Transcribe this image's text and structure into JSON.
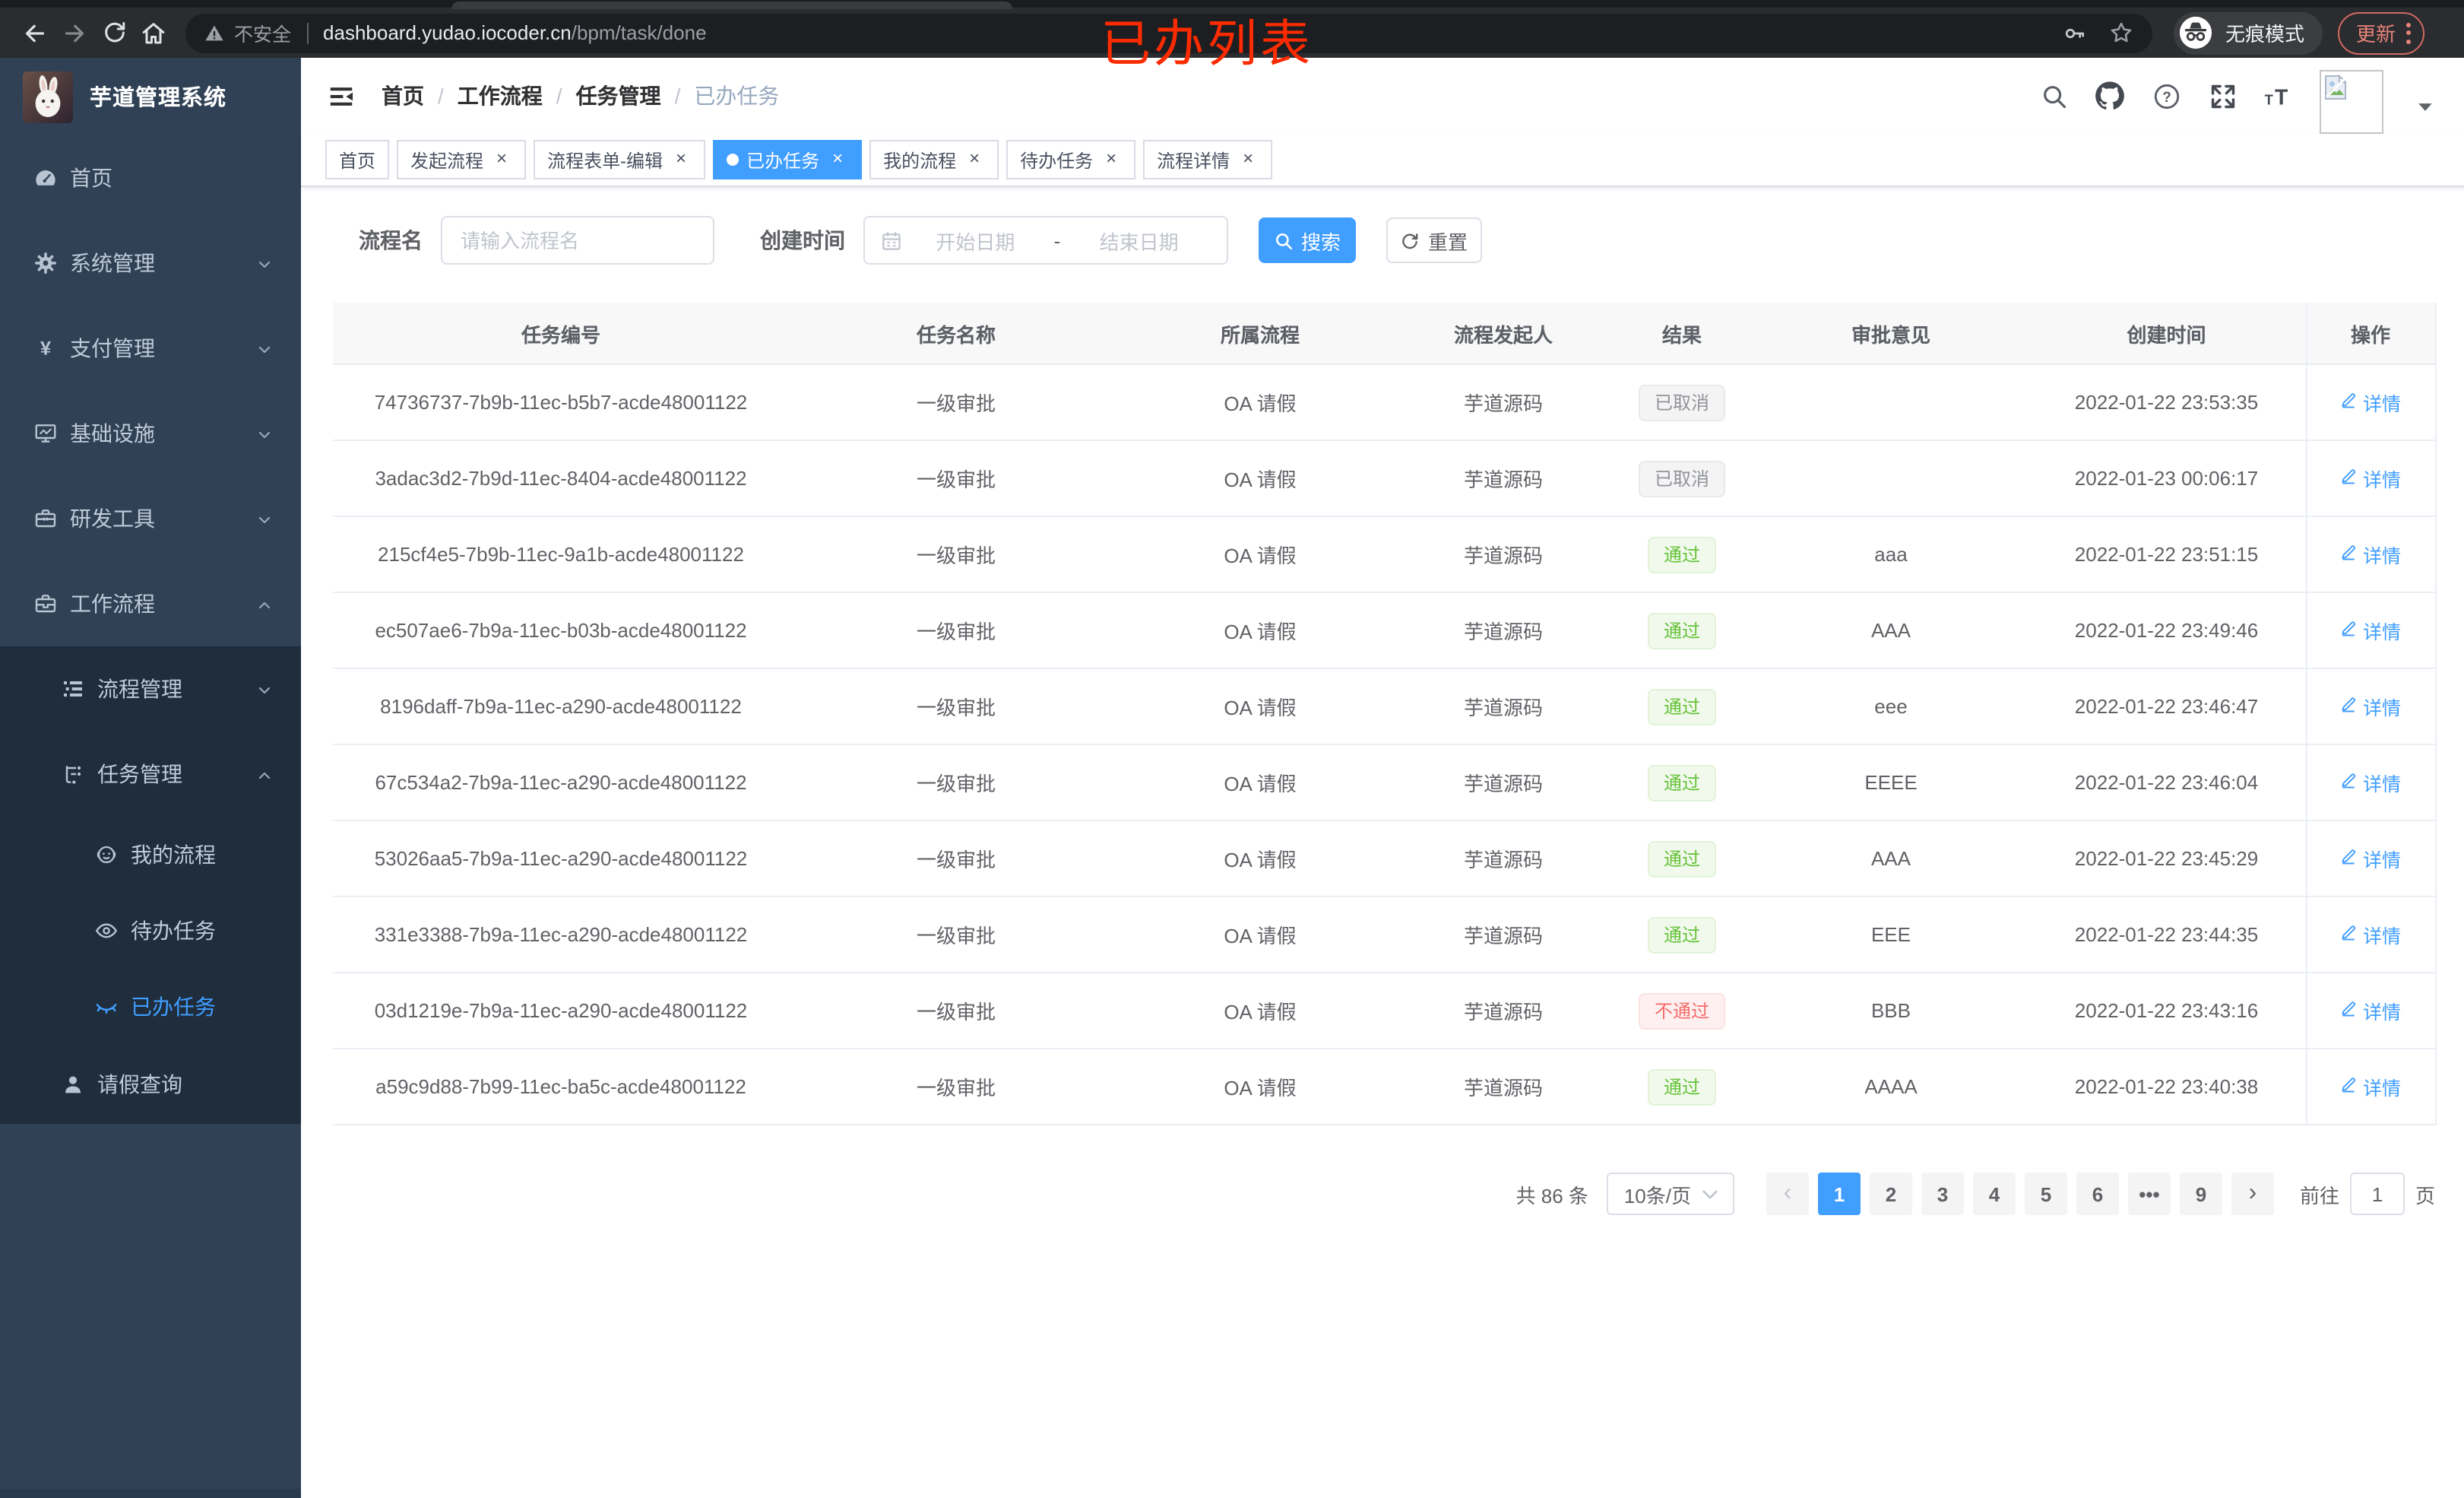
{
  "annotation": {
    "text": "已办列表",
    "color": "#fd2b01"
  },
  "browser": {
    "insecure_label": "不安全",
    "url_host": "dashboard.yudao.iocoder.cn",
    "url_path": "/bpm/task/done",
    "incognito_label": "无痕模式",
    "update_label": "更新"
  },
  "sidebar": {
    "title": "芋道管理系统",
    "items": [
      {
        "label": "首页",
        "icon": "dashboard-icon",
        "level": 1
      },
      {
        "label": "系统管理",
        "icon": "gear-icon",
        "level": 1,
        "chevron": "down"
      },
      {
        "label": "支付管理",
        "icon": "yen-icon",
        "level": 1,
        "chevron": "down"
      },
      {
        "label": "基础设施",
        "icon": "monitor-icon",
        "level": 1,
        "chevron": "down"
      },
      {
        "label": "研发工具",
        "icon": "toolbox-icon",
        "level": 1,
        "chevron": "down"
      },
      {
        "label": "工作流程",
        "icon": "briefcase-icon",
        "level": 1,
        "chevron": "up"
      },
      {
        "label": "流程管理",
        "icon": "list-tree-icon",
        "level": 2,
        "chevron": "down",
        "group": true
      },
      {
        "label": "任务管理",
        "icon": "tasks-icon",
        "level": 2,
        "chevron": "up",
        "group": true
      },
      {
        "label": "我的流程",
        "icon": "robot-icon",
        "level": 3,
        "group": true
      },
      {
        "label": "待办任务",
        "icon": "eye-open-icon",
        "level": 3,
        "group": true
      },
      {
        "label": "已办任务",
        "icon": "eye-closed-icon",
        "level": 3,
        "group": true,
        "active": true
      },
      {
        "label": "请假查询",
        "icon": "user-icon",
        "level": 2,
        "group": true,
        "leave": true
      }
    ]
  },
  "navbar": {
    "breadcrumb": [
      "首页",
      "工作流程",
      "任务管理",
      "已办任务"
    ]
  },
  "tags": {
    "items": [
      {
        "label": "首页"
      },
      {
        "label": "发起流程",
        "closable": true
      },
      {
        "label": "流程表单-编辑",
        "closable": true
      },
      {
        "label": "已办任务",
        "closable": true,
        "active": true
      },
      {
        "label": "我的流程",
        "closable": true
      },
      {
        "label": "待办任务",
        "closable": true
      },
      {
        "label": "流程详情",
        "closable": true
      }
    ]
  },
  "filters": {
    "name_label": "流程名",
    "name_placeholder": "请输入流程名",
    "time_label": "创建时间",
    "start_placeholder": "开始日期",
    "range_separator": "-",
    "end_placeholder": "结束日期",
    "search_label": "搜索",
    "reset_label": "重置"
  },
  "table": {
    "columns": [
      "任务编号",
      "任务名称",
      "所属流程",
      "流程发起人",
      "结果",
      "审批意见",
      "创建时间",
      "操作"
    ],
    "action_label": "详情",
    "rows": [
      {
        "id": "74736737-7b9b-11ec-b5b7-acde48001122",
        "name": "一级审批",
        "process": "OA 请假",
        "starter": "芋道源码",
        "result": "已取消",
        "result_type": "cancel",
        "comment": "",
        "created": "2022-01-22 23:53:35"
      },
      {
        "id": "3adac3d2-7b9d-11ec-8404-acde48001122",
        "name": "一级审批",
        "process": "OA 请假",
        "starter": "芋道源码",
        "result": "已取消",
        "result_type": "cancel",
        "comment": "",
        "created": "2022-01-23 00:06:17"
      },
      {
        "id": "215cf4e5-7b9b-11ec-9a1b-acde48001122",
        "name": "一级审批",
        "process": "OA 请假",
        "starter": "芋道源码",
        "result": "通过",
        "result_type": "pass",
        "comment": "aaa",
        "created": "2022-01-22 23:51:15"
      },
      {
        "id": "ec507ae6-7b9a-11ec-b03b-acde48001122",
        "name": "一级审批",
        "process": "OA 请假",
        "starter": "芋道源码",
        "result": "通过",
        "result_type": "pass",
        "comment": "AAA",
        "created": "2022-01-22 23:49:46"
      },
      {
        "id": "8196daff-7b9a-11ec-a290-acde48001122",
        "name": "一级审批",
        "process": "OA 请假",
        "starter": "芋道源码",
        "result": "通过",
        "result_type": "pass",
        "comment": "eee",
        "created": "2022-01-22 23:46:47"
      },
      {
        "id": "67c534a2-7b9a-11ec-a290-acde48001122",
        "name": "一级审批",
        "process": "OA 请假",
        "starter": "芋道源码",
        "result": "通过",
        "result_type": "pass",
        "comment": "EEEE",
        "created": "2022-01-22 23:46:04"
      },
      {
        "id": "53026aa5-7b9a-11ec-a290-acde48001122",
        "name": "一级审批",
        "process": "OA 请假",
        "starter": "芋道源码",
        "result": "通过",
        "result_type": "pass",
        "comment": "AAA",
        "created": "2022-01-22 23:45:29"
      },
      {
        "id": "331e3388-7b9a-11ec-a290-acde48001122",
        "name": "一级审批",
        "process": "OA 请假",
        "starter": "芋道源码",
        "result": "通过",
        "result_type": "pass",
        "comment": "EEE",
        "created": "2022-01-22 23:44:35"
      },
      {
        "id": "03d1219e-7b9a-11ec-a290-acde48001122",
        "name": "一级审批",
        "process": "OA 请假",
        "starter": "芋道源码",
        "result": "不通过",
        "result_type": "reject",
        "comment": "BBB",
        "created": "2022-01-22 23:43:16"
      },
      {
        "id": "a59c9d88-7b99-11ec-ba5c-acde48001122",
        "name": "一级审批",
        "process": "OA 请假",
        "starter": "芋道源码",
        "result": "通过",
        "result_type": "pass",
        "comment": "AAAA",
        "created": "2022-01-22 23:40:38"
      }
    ]
  },
  "pagination": {
    "total_label": "共 86 条",
    "page_size": "10条/页",
    "pages": [
      "1",
      "2",
      "3",
      "4",
      "5",
      "6",
      "•••",
      "9"
    ],
    "active_page": "1",
    "goto_label": "前往",
    "goto_value": "1",
    "page_label": "页"
  },
  "colors": {
    "accent": "#409eff",
    "sidebar_bg": "#304156",
    "submenu_bg": "#1f2d3d",
    "pass": "#67c23a",
    "reject": "#f56c6c",
    "cancel": "#909399"
  }
}
